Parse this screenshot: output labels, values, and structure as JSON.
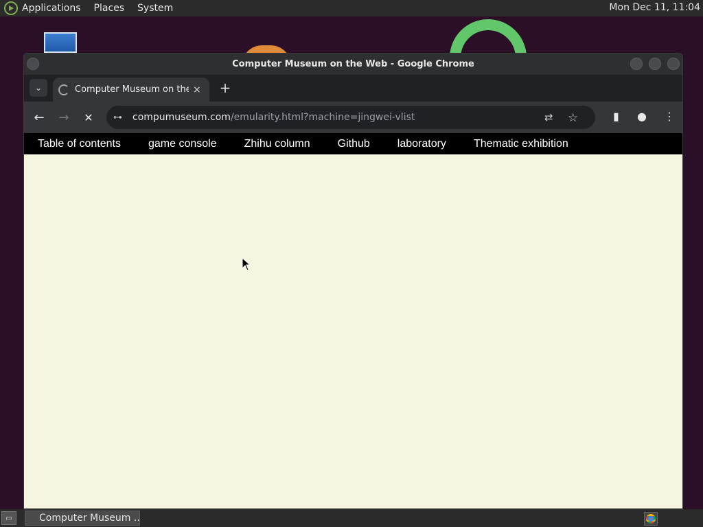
{
  "top_panel": {
    "menus": [
      "Applications",
      "Places",
      "System"
    ],
    "clock": "Mon Dec 11, 11:04"
  },
  "window": {
    "title": "Computer Museum on the Web - Google Chrome"
  },
  "tabs": [
    {
      "title": "Computer Museum on the W",
      "close": "×"
    }
  ],
  "tab_list_glyph": "⌄",
  "new_tab_glyph": "+",
  "toolbar": {
    "back": "←",
    "forward": "→",
    "stop": "✕",
    "site_info": "⊶",
    "url_host": "compumuseum.com",
    "url_path": "/emularity.html?machine=jingwei-vlist",
    "translate": "⇄",
    "bookmark": "☆",
    "side_panel": "▮",
    "profile": "●",
    "menu": "⋮"
  },
  "site_nav": [
    "Table of contents",
    "game console",
    "Zhihu column",
    "Github",
    "laboratory",
    "Thematic exhibition"
  ],
  "taskbar": {
    "show_desktop": "▭",
    "task_title": "Computer Museum ..."
  },
  "colors": {
    "page_background": "#f6f6e0",
    "nav_background": "#000000",
    "chrome_frame": "#35363a"
  }
}
